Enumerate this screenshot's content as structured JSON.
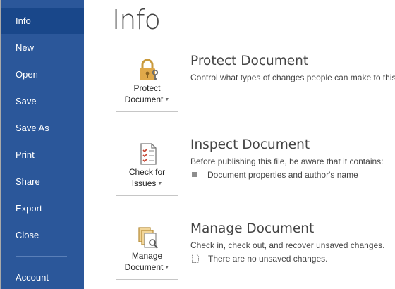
{
  "sidebar": {
    "items": [
      {
        "label": "Info",
        "active": true
      },
      {
        "label": "New"
      },
      {
        "label": "Open"
      },
      {
        "label": "Save"
      },
      {
        "label": "Save As"
      },
      {
        "label": "Print"
      },
      {
        "label": "Share"
      },
      {
        "label": "Export"
      },
      {
        "label": "Close"
      },
      {
        "label": "Account"
      }
    ]
  },
  "page": {
    "title": "Info"
  },
  "sections": {
    "protect": {
      "tile_line1": "Protect",
      "tile_line2": "Document",
      "title": "Protect Document",
      "description": "Control what types of changes people can make to this document.",
      "icon": "lock-icon"
    },
    "inspect": {
      "tile_line1": "Check for",
      "tile_line2": "Issues",
      "title": "Inspect Document",
      "description": "Before publishing this file, be aware that it contains:",
      "bullet": "Document properties and author's name",
      "icon": "checklist-icon"
    },
    "manage": {
      "tile_line1": "Manage",
      "tile_line2": "Document",
      "title": "Manage Document",
      "description": "Check in, check out, and recover unsaved changes.",
      "status": "There are no unsaved changes.",
      "icon": "manage-documents-icon"
    }
  },
  "colors": {
    "sidebar_bg": "#2b579a",
    "sidebar_active": "#19478a",
    "accent_gold": "#e0a94a"
  }
}
